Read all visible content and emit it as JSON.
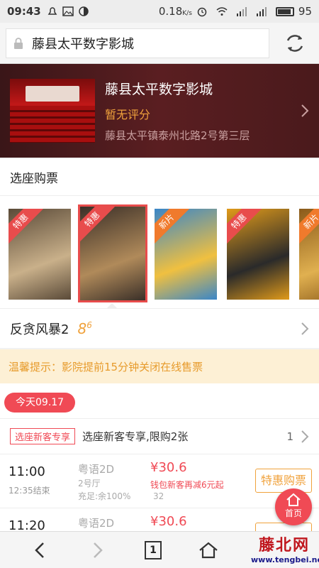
{
  "status": {
    "time": "09:43",
    "net_speed": "0.18",
    "net_unit": "K/s",
    "battery": "95"
  },
  "browser": {
    "url_title": "藤县太平数字影城",
    "tab_count": "1"
  },
  "cinema": {
    "name": "藤县太平数字影城",
    "rating": "暂无评分",
    "address": "藤县太平镇泰州北路2号第三层"
  },
  "section": {
    "title": "选座购票"
  },
  "posters": [
    {
      "badge": "特惠",
      "badge_color": "#e84c4c",
      "bg": "#5a4a38",
      "accent": "#c9b08a"
    },
    {
      "badge": "特惠",
      "badge_color": "#e84c4c",
      "bg": "#3a2f28",
      "accent": "#b08a5a"
    },
    {
      "badge": "新片",
      "badge_color": "#f07a2c",
      "bg": "#3a86c8",
      "accent": "#f0c040"
    },
    {
      "badge": "特惠",
      "badge_color": "#e84c4c",
      "bg": "#e09a1a",
      "accent": "#2a2a2a"
    },
    {
      "badge": "新片",
      "badge_color": "#f07a2c",
      "bg": "#8a5a1a",
      "accent": "#e0b050"
    }
  ],
  "movie": {
    "title": "反贪风暴2",
    "score_int": "8",
    "score_dec": "6"
  },
  "notice": {
    "text": "温馨提示：影院提前15分钟关闭在线售票"
  },
  "date": {
    "label": "今天09.17"
  },
  "promo": {
    "tag": "选座新客专享",
    "text": "选座新客专享,限购2张",
    "count": "1"
  },
  "showtimes": [
    {
      "start": "11:00",
      "end": "12:35结束",
      "lang": "粤语2D",
      "hall": "2号厅",
      "seats": "充足:余100%",
      "price": "¥30.6",
      "discount": "钱包新客再减6元起",
      "orig": "32",
      "buy": "特惠购票"
    },
    {
      "start": "11:20",
      "lang": "粤语2D",
      "price": "¥30.6"
    }
  ],
  "fab": {
    "label": "首页"
  },
  "watermark": {
    "cn": "藤北网",
    "url": "www.tengbei.net"
  },
  "colors": {
    "accent_red": "#f04a55",
    "accent_orange": "#f0a23c",
    "header_bg": "#4a1a1c"
  }
}
